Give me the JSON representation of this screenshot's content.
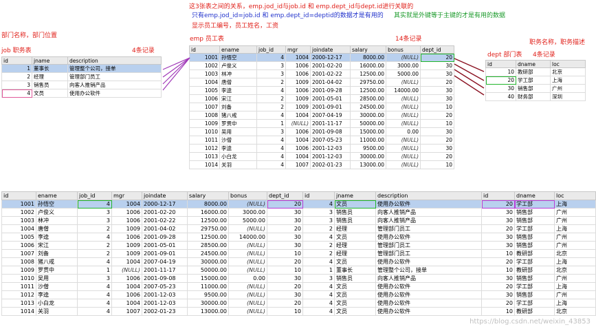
{
  "notes": {
    "top1": "这3张表之间的关系，emp.jod_id与job.id 和 emp.dept_id与dept.id进行关联的",
    "top2a": "只有emp.jod_id=job.id 和 emp.dept_id=deptid的数据才是有用的",
    "top2b": "其实就是外键等于主键的才是有用的数据",
    "top3": "显示员工编号，员工姓名，工资",
    "dept_loc": "部门名称，部门位置",
    "job_title": "job 职务表",
    "job_count": "4条记录",
    "emp_title": "emp 员工表",
    "emp_count": "14条记录",
    "dept_title": "dept 部门表",
    "dept_count": "4条记录",
    "job_desc": "职务名称，职务描述",
    "watermark": "https://blog.csdn.net/weixin_43853"
  },
  "job": {
    "columns": [
      "id",
      "jname",
      "description"
    ],
    "rows": [
      [
        "1",
        "董事长",
        "管理整个公司，接单"
      ],
      [
        "2",
        "经理",
        "管理部门员工"
      ],
      [
        "3",
        "销售员",
        "向客人推销产品"
      ],
      [
        "4",
        "文员",
        "使用办公软件"
      ]
    ]
  },
  "emp": {
    "columns": [
      "id",
      "ename",
      "job_id",
      "mgr",
      "joindate",
      "salary",
      "bonus",
      "dept_id"
    ],
    "rows": [
      [
        "1001",
        "孙悟空",
        "4",
        "1004",
        "2000-12-17",
        "8000.00",
        "(NULL)",
        "20"
      ],
      [
        "1002",
        "卢俊义",
        "3",
        "1006",
        "2001-02-20",
        "16000.00",
        "3000.00",
        "30"
      ],
      [
        "1003",
        "林冲",
        "3",
        "1006",
        "2001-02-22",
        "12500.00",
        "5000.00",
        "30"
      ],
      [
        "1004",
        "唐僧",
        "2",
        "1009",
        "2001-04-02",
        "29750.00",
        "(NULL)",
        "20"
      ],
      [
        "1005",
        "李逵",
        "4",
        "1006",
        "2001-09-28",
        "12500.00",
        "14000.00",
        "30"
      ],
      [
        "1006",
        "宋江",
        "2",
        "1009",
        "2001-05-01",
        "28500.00",
        "(NULL)",
        "30"
      ],
      [
        "1007",
        "刘备",
        "2",
        "1009",
        "2001-09-01",
        "24500.00",
        "(NULL)",
        "10"
      ],
      [
        "1008",
        "猪八戒",
        "4",
        "1004",
        "2007-04-19",
        "30000.00",
        "(NULL)",
        "20"
      ],
      [
        "1009",
        "罗贯中",
        "1",
        "(NULL)",
        "2001-11-17",
        "50000.00",
        "(NULL)",
        "10"
      ],
      [
        "1010",
        "吴用",
        "3",
        "1006",
        "2001-09-08",
        "15000.00",
        "0.00",
        "30"
      ],
      [
        "1011",
        "沙僧",
        "4",
        "1004",
        "2007-05-23",
        "11000.00",
        "(NULL)",
        "20"
      ],
      [
        "1012",
        "李逵",
        "4",
        "1006",
        "2001-12-03",
        "9500.00",
        "(NULL)",
        "30"
      ],
      [
        "1013",
        "小白龙",
        "4",
        "1004",
        "2001-12-03",
        "30000.00",
        "(NULL)",
        "20"
      ],
      [
        "1014",
        "关羽",
        "4",
        "1007",
        "2002-01-23",
        "13000.00",
        "(NULL)",
        "10"
      ]
    ]
  },
  "dept": {
    "columns": [
      "id",
      "dname",
      "loc"
    ],
    "rows": [
      [
        "10",
        "教研部",
        "北京"
      ],
      [
        "20",
        "学工部",
        "上海"
      ],
      [
        "30",
        "销售部",
        "广州"
      ],
      [
        "40",
        "财务部",
        "深圳"
      ]
    ]
  },
  "joined": {
    "columns": [
      "id",
      "ename",
      "job_id",
      "mgr",
      "joindate",
      "salary",
      "bonus",
      "dept_id",
      "id",
      "jname",
      "description",
      "id",
      "dname",
      "loc"
    ],
    "rows": [
      [
        "1001",
        "孙悟空",
        "4",
        "1004",
        "2000-12-17",
        "8000.00",
        "(NULL)",
        "20",
        "4",
        "文员",
        "使用办公软件",
        "20",
        "学工部",
        "上海"
      ],
      [
        "1002",
        "卢俊义",
        "3",
        "1006",
        "2001-02-20",
        "16000.00",
        "3000.00",
        "30",
        "3",
        "销售员",
        "向客人推销产品",
        "30",
        "销售部",
        "广州"
      ],
      [
        "1003",
        "林冲",
        "3",
        "1006",
        "2001-02-22",
        "12500.00",
        "5000.00",
        "30",
        "3",
        "销售员",
        "向客人推销产品",
        "30",
        "销售部",
        "广州"
      ],
      [
        "1004",
        "唐僧",
        "2",
        "1009",
        "2001-04-02",
        "29750.00",
        "(NULL)",
        "20",
        "2",
        "经理",
        "管理部门员工",
        "20",
        "学工部",
        "上海"
      ],
      [
        "1005",
        "李逵",
        "4",
        "1006",
        "2001-09-28",
        "12500.00",
        "14000.00",
        "30",
        "4",
        "文员",
        "使用办公软件",
        "30",
        "销售部",
        "广州"
      ],
      [
        "1006",
        "宋江",
        "2",
        "1009",
        "2001-05-01",
        "28500.00",
        "(NULL)",
        "30",
        "2",
        "经理",
        "管理部门员工",
        "30",
        "销售部",
        "广州"
      ],
      [
        "1007",
        "刘备",
        "2",
        "1009",
        "2001-09-01",
        "24500.00",
        "(NULL)",
        "10",
        "2",
        "经理",
        "管理部门员工",
        "10",
        "教研部",
        "北京"
      ],
      [
        "1008",
        "猪八戒",
        "4",
        "1004",
        "2007-04-19",
        "30000.00",
        "(NULL)",
        "20",
        "4",
        "文员",
        "使用办公软件",
        "20",
        "学工部",
        "上海"
      ],
      [
        "1009",
        "罗贯中",
        "1",
        "(NULL)",
        "2001-11-17",
        "50000.00",
        "(NULL)",
        "10",
        "1",
        "董事长",
        "管理整个公司，接单",
        "10",
        "教研部",
        "北京"
      ],
      [
        "1010",
        "吴用",
        "3",
        "1006",
        "2001-09-08",
        "15000.00",
        "0.00",
        "30",
        "3",
        "销售员",
        "向客人推销产品",
        "30",
        "销售部",
        "广州"
      ],
      [
        "1011",
        "沙僧",
        "4",
        "1004",
        "2007-05-23",
        "11000.00",
        "(NULL)",
        "20",
        "4",
        "文员",
        "使用办公软件",
        "20",
        "学工部",
        "上海"
      ],
      [
        "1012",
        "李逵",
        "4",
        "1006",
        "2001-12-03",
        "9500.00",
        "(NULL)",
        "30",
        "4",
        "文员",
        "使用办公软件",
        "30",
        "销售部",
        "广州"
      ],
      [
        "1013",
        "小白龙",
        "4",
        "1004",
        "2001-12-03",
        "30000.00",
        "(NULL)",
        "20",
        "4",
        "文员",
        "使用办公软件",
        "20",
        "学工部",
        "上海"
      ],
      [
        "1014",
        "关羽",
        "4",
        "1007",
        "2002-01-23",
        "13000.00",
        "(NULL)",
        "10",
        "4",
        "文员",
        "使用办公软件",
        "10",
        "教研部",
        "北京"
      ]
    ]
  },
  "colors": {
    "annotation_red": "#e0201a",
    "annotation_blue": "#2233cc",
    "annotation_green": "#1a9a2a",
    "arrow_purple": "#a038b8",
    "arrow_darkred": "#8a1020",
    "selected_row": "#b9d0ee"
  }
}
